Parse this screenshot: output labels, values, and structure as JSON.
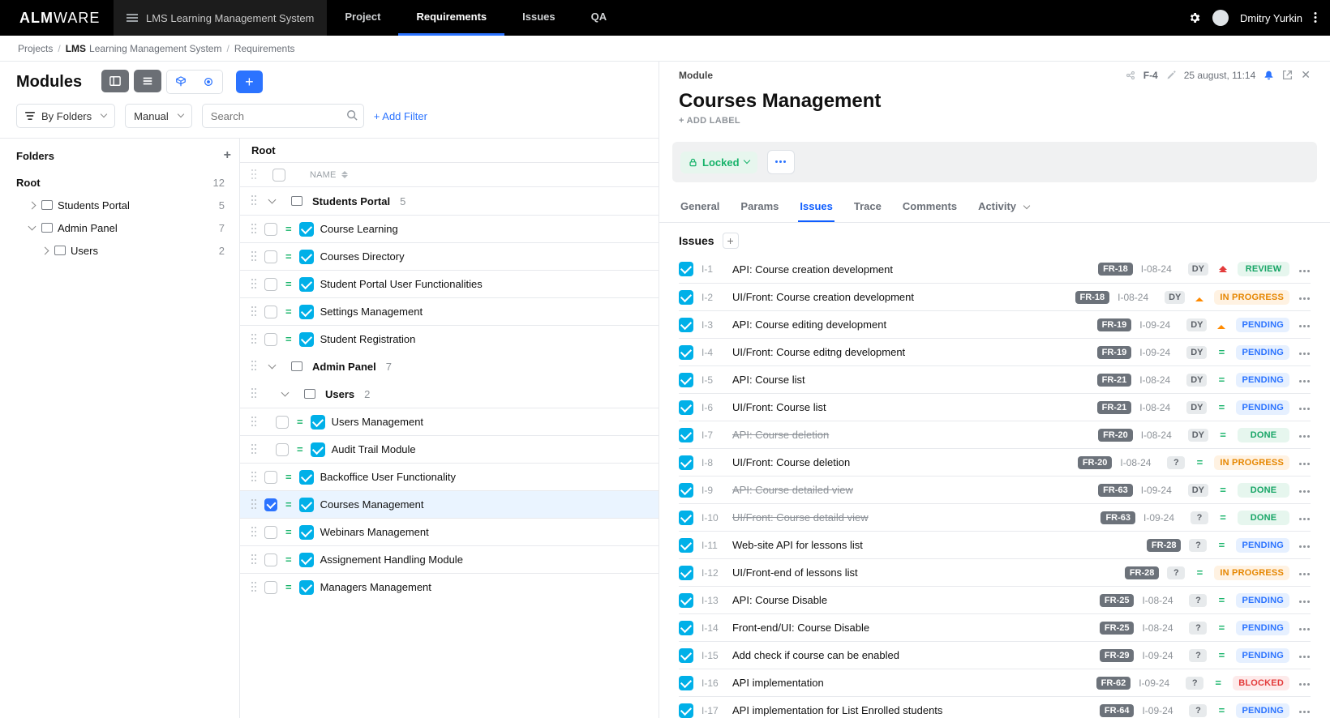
{
  "app": {
    "logo_main": "ALM",
    "logo_thin": "WARE",
    "project_switch": "LMS Learning Management System"
  },
  "nav": {
    "project": "Project",
    "requirements": "Requirements",
    "issues": "Issues",
    "qa": "QA"
  },
  "user": {
    "name": "Dmitry Yurkin"
  },
  "breadcrumb": {
    "root": "Projects",
    "project": "LMS",
    "project_sub": "Learning Management System",
    "page": "Requirements"
  },
  "left": {
    "title": "Modules",
    "sort_by_label": "By Folders",
    "view_label": "Manual",
    "search_placeholder": "Search",
    "add_filter": "+ Add Filter",
    "folders_title": "Folders",
    "folders": [
      {
        "label": "Root",
        "count": "12",
        "indent": 0,
        "chev": "",
        "folder": false,
        "bold": true
      },
      {
        "label": "Students Portal",
        "count": "5",
        "indent": 1,
        "chev": "closed",
        "folder": true
      },
      {
        "label": "Admin Panel",
        "count": "7",
        "indent": 1,
        "chev": "open",
        "folder": true
      },
      {
        "label": "Users",
        "count": "2",
        "indent": 2,
        "chev": "closed",
        "folder": true
      }
    ],
    "tree_root": "Root",
    "col_name": "NAME",
    "groups": [
      {
        "type": "group",
        "label": "Students Portal",
        "count": "5",
        "indent": 1
      },
      {
        "type": "row",
        "label": "Course Learning",
        "indent": 2,
        "checked": false
      },
      {
        "type": "row",
        "label": "Courses Directory",
        "indent": 2,
        "checked": false
      },
      {
        "type": "row",
        "label": "Student Portal User Functionalities",
        "indent": 2,
        "checked": false
      },
      {
        "type": "row",
        "label": "Settings Management",
        "indent": 2,
        "checked": false
      },
      {
        "type": "row",
        "label": "Student Registration",
        "indent": 2,
        "checked": false
      },
      {
        "type": "group",
        "label": "Admin Panel",
        "count": "7",
        "indent": 1
      },
      {
        "type": "group",
        "label": "Users",
        "count": "2",
        "indent": 2
      },
      {
        "type": "row",
        "label": "Users Management",
        "indent": 3,
        "checked": false
      },
      {
        "type": "row",
        "label": "Audit Trail Module",
        "indent": 3,
        "checked": false
      },
      {
        "type": "row",
        "label": "Backoffice User Functionality",
        "indent": 2,
        "checked": false
      },
      {
        "type": "row",
        "label": "Courses Management",
        "indent": 2,
        "checked": true
      },
      {
        "type": "row",
        "label": "Webinars Management",
        "indent": 2,
        "checked": false
      },
      {
        "type": "row",
        "label": "Assignement Handling Module",
        "indent": 2,
        "checked": false
      },
      {
        "type": "row",
        "label": "Managers Management",
        "indent": 2,
        "checked": false
      }
    ]
  },
  "detail": {
    "chip": "Module",
    "link": "F-4",
    "modified": "25 august, 11:14",
    "title": "Courses Management",
    "add_label": "+ ADD LABEL",
    "locked": "Locked",
    "tabs": {
      "general": "General",
      "params": "Params",
      "issues": "Issues",
      "trace": "Trace",
      "comments": "Comments",
      "activity": "Activity"
    },
    "issues_title": "Issues",
    "issues": [
      {
        "id": "I-1",
        "title": "API: Course creation development",
        "fr": "FR-18",
        "date": "I-08-24",
        "assignee": "DY",
        "prio": "hi",
        "status": "REVIEW",
        "strike": false
      },
      {
        "id": "I-2",
        "title": "UI/Front: Course creation development",
        "fr": "FR-18",
        "date": "I-08-24",
        "assignee": "DY",
        "prio": "med",
        "status": "IN PROGRESS",
        "strike": false
      },
      {
        "id": "I-3",
        "title": "API: Course editing development",
        "fr": "FR-19",
        "date": "I-09-24",
        "assignee": "DY",
        "prio": "med",
        "status": "PENDING",
        "strike": false
      },
      {
        "id": "I-4",
        "title": "UI/Front: Course editng development",
        "fr": "FR-19",
        "date": "I-09-24",
        "assignee": "DY",
        "prio": "eq",
        "status": "PENDING",
        "strike": false
      },
      {
        "id": "I-5",
        "title": "API: Course list",
        "fr": "FR-21",
        "date": "I-08-24",
        "assignee": "DY",
        "prio": "eq",
        "status": "PENDING",
        "strike": false
      },
      {
        "id": "I-6",
        "title": "UI/Front: Course list",
        "fr": "FR-21",
        "date": "I-08-24",
        "assignee": "DY",
        "prio": "eq",
        "status": "PENDING",
        "strike": false
      },
      {
        "id": "I-7",
        "title": "API: Course deletion",
        "fr": "FR-20",
        "date": "I-08-24",
        "assignee": "DY",
        "prio": "eq",
        "status": "DONE",
        "strike": true
      },
      {
        "id": "I-8",
        "title": "UI/Front: Course deletion",
        "fr": "FR-20",
        "date": "I-08-24",
        "assignee": "?",
        "prio": "eq",
        "status": "IN PROGRESS",
        "strike": false
      },
      {
        "id": "I-9",
        "title": "API: Course detailed view",
        "fr": "FR-63",
        "date": "I-09-24",
        "assignee": "DY",
        "prio": "eq",
        "status": "DONE",
        "strike": true
      },
      {
        "id": "I-10",
        "title": "UI/Front: Course detaild view",
        "fr": "FR-63",
        "date": "I-09-24",
        "assignee": "?",
        "prio": "eq",
        "status": "DONE",
        "strike": true
      },
      {
        "id": "I-11",
        "title": "Web-site API for lessons list",
        "fr": "FR-28",
        "date": "",
        "assignee": "?",
        "prio": "eq",
        "status": "PENDING",
        "strike": false
      },
      {
        "id": "I-12",
        "title": "UI/Front-end of lessons list",
        "fr": "FR-28",
        "date": "",
        "assignee": "?",
        "prio": "eq",
        "status": "IN PROGRESS",
        "strike": false
      },
      {
        "id": "I-13",
        "title": "API: Course Disable",
        "fr": "FR-25",
        "date": "I-08-24",
        "assignee": "?",
        "prio": "eq",
        "status": "PENDING",
        "strike": false
      },
      {
        "id": "I-14",
        "title": "Front-end/UI: Course Disable",
        "fr": "FR-25",
        "date": "I-08-24",
        "assignee": "?",
        "prio": "eq",
        "status": "PENDING",
        "strike": false
      },
      {
        "id": "I-15",
        "title": "Add check if course can be enabled",
        "fr": "FR-29",
        "date": "I-09-24",
        "assignee": "?",
        "prio": "eq",
        "status": "PENDING",
        "strike": false
      },
      {
        "id": "I-16",
        "title": "API implementation",
        "fr": "FR-62",
        "date": "I-09-24",
        "assignee": "?",
        "prio": "eq",
        "status": "BLOCKED",
        "strike": false
      },
      {
        "id": "I-17",
        "title": "API implementation for List Enrolled students",
        "fr": "FR-64",
        "date": "I-09-24",
        "assignee": "?",
        "prio": "eq",
        "status": "PENDING",
        "strike": false
      }
    ]
  }
}
